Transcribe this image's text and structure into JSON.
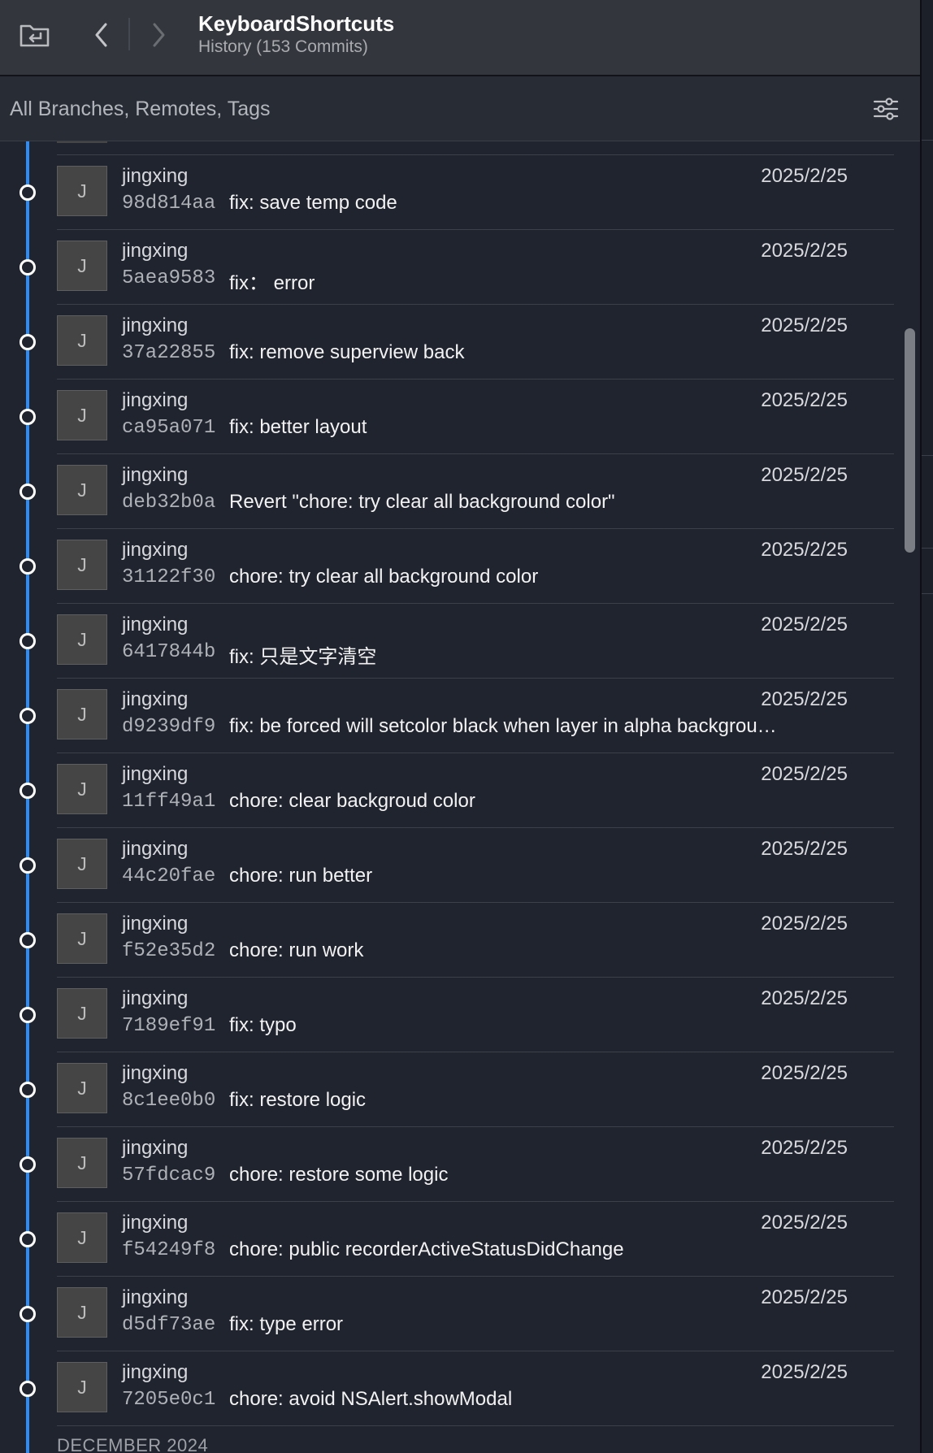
{
  "titlebar": {
    "title": "KeyboardShortcuts",
    "subtitle": "History (153 Commits)",
    "buttons": [
      "open-repo-icon",
      "back-chevron-icon",
      "forward-chevron-icon"
    ]
  },
  "filter": {
    "label": "All Branches, Remotes, Tags",
    "icon": "sliders-icon"
  },
  "colors": {
    "rail": "#2f8cf5",
    "background": "#20242e",
    "titlebar": "#33363d"
  },
  "commits": [
    {
      "initial": "J",
      "author": "jingxing",
      "date": "2025/2/25",
      "hash": "98d814aa",
      "message": "fix: save temp code"
    },
    {
      "initial": "J",
      "author": "jingxing",
      "date": "2025/2/25",
      "hash": "5aea9583",
      "message": "fix： error"
    },
    {
      "initial": "J",
      "author": "jingxing",
      "date": "2025/2/25",
      "hash": "37a22855",
      "message": "fix: remove superview back"
    },
    {
      "initial": "J",
      "author": "jingxing",
      "date": "2025/2/25",
      "hash": "ca95a071",
      "message": "fix: better layout"
    },
    {
      "initial": "J",
      "author": "jingxing",
      "date": "2025/2/25",
      "hash": "deb32b0a",
      "message": "Revert \"chore: try clear all background color\""
    },
    {
      "initial": "J",
      "author": "jingxing",
      "date": "2025/2/25",
      "hash": "31122f30",
      "message": "chore: try clear all background color"
    },
    {
      "initial": "J",
      "author": "jingxing",
      "date": "2025/2/25",
      "hash": "6417844b",
      "message": "fix: 只是文字清空"
    },
    {
      "initial": "J",
      "author": "jingxing",
      "date": "2025/2/25",
      "hash": "d9239df9",
      "message": "fix:  be forced will setcolor black when layer in alpha backgrou…"
    },
    {
      "initial": "J",
      "author": "jingxing",
      "date": "2025/2/25",
      "hash": "11ff49a1",
      "message": "chore: clear backgroud color"
    },
    {
      "initial": "J",
      "author": "jingxing",
      "date": "2025/2/25",
      "hash": "44c20fae",
      "message": "chore: run better"
    },
    {
      "initial": "J",
      "author": "jingxing",
      "date": "2025/2/25",
      "hash": "f52e35d2",
      "message": "chore: run work"
    },
    {
      "initial": "J",
      "author": "jingxing",
      "date": "2025/2/25",
      "hash": "7189ef91",
      "message": "fix: typo"
    },
    {
      "initial": "J",
      "author": "jingxing",
      "date": "2025/2/25",
      "hash": "8c1ee0b0",
      "message": "fix: restore logic"
    },
    {
      "initial": "J",
      "author": "jingxing",
      "date": "2025/2/25",
      "hash": "57fdcac9",
      "message": "chore: restore some logic"
    },
    {
      "initial": "J",
      "author": "jingxing",
      "date": "2025/2/25",
      "hash": "f54249f8",
      "message": "chore: public recorderActiveStatusDidChange"
    },
    {
      "initial": "J",
      "author": "jingxing",
      "date": "2025/2/25",
      "hash": "d5df73ae",
      "message": "fix: type error"
    },
    {
      "initial": "J",
      "author": "jingxing",
      "date": "2025/2/25",
      "hash": "7205e0c1",
      "message": "chore: avoid NSAlert.showModal"
    }
  ],
  "section_header": "DECEMBER 2024"
}
